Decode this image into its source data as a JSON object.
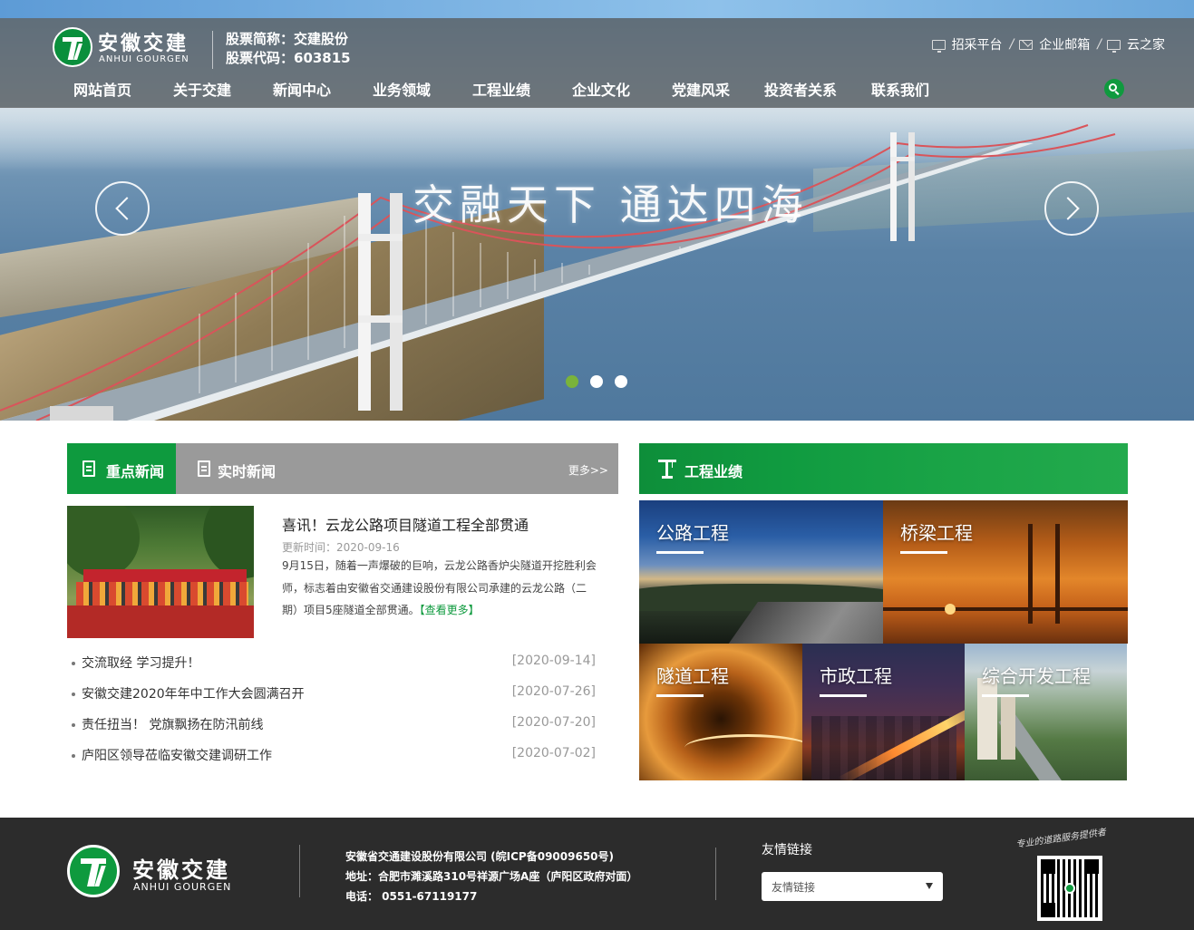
{
  "header": {
    "logo_cn": "安徽交建",
    "logo_en": "ANHUI GOURGEN",
    "stock_abbr": "股票简称：交建股份",
    "stock_code": "股票代码：603815",
    "top_links": [
      {
        "label": "招采平台",
        "icon": "monitor-icon"
      },
      {
        "label": "企业邮箱",
        "icon": "mail-icon"
      },
      {
        "label": "云之家",
        "icon": "monitor-icon"
      }
    ],
    "nav": [
      "网站首页",
      "关于交建",
      "新闻中心",
      "业务领域",
      "工程业绩",
      "企业文化",
      "党建风采",
      "投资者关系",
      "联系我们"
    ]
  },
  "hero": {
    "slogan": "交融天下  通达四海",
    "slides": 3,
    "active_slide": 1
  },
  "news": {
    "tab_focus": "重点新闻",
    "tab_realtime": "实时新闻",
    "more": "更多>>",
    "featured": {
      "title": "喜讯！云龙公路项目隧道工程全部贯通",
      "date": "更新时间：2020-09-16",
      "body": "9月15日，随着一声爆破的巨响，云龙公路香炉尖隧道开挖胜利会师，标志着由安徽省交通建设股份有限公司承建的云龙公路（二期）项目5座隧道全部贯通。",
      "see_more": "【查看更多】"
    },
    "items": [
      {
        "title": "交流取经 学习提升！",
        "date": "[2020-09-14]"
      },
      {
        "title": "安徽交建2020年年中工作大会圆满召开",
        "date": "[2020-07-26]"
      },
      {
        "title": "责任扭当！ 党旗飘扬在防汛前线",
        "date": "[2020-07-20]"
      },
      {
        "title": "庐阳区领导莅临安徽交建调研工作",
        "date": "[2020-07-02]"
      }
    ]
  },
  "projects": {
    "title": "工程业绩",
    "tiles": [
      "公路工程",
      "桥梁工程",
      "隧道工程",
      "市政工程",
      "综合开发工程"
    ]
  },
  "footer": {
    "logo_cn": "安徽交建",
    "logo_en": "ANHUI GOURGEN",
    "company": "安徽省交通建设股份有限公司 (皖ICP备09009650号)",
    "address": "地址：合肥市濉溪路310号祥源广场A座（庐阳区政府对面）",
    "phone": "电话： 0551-67119177",
    "links_title": "友情链接",
    "links_select": "友情链接",
    "slogan": "专业的道路服务提供者"
  },
  "colors": {
    "brand_green": "#0e9a3e",
    "active_dot": "#7ab33a",
    "footer_bg": "#2c2c2c"
  }
}
